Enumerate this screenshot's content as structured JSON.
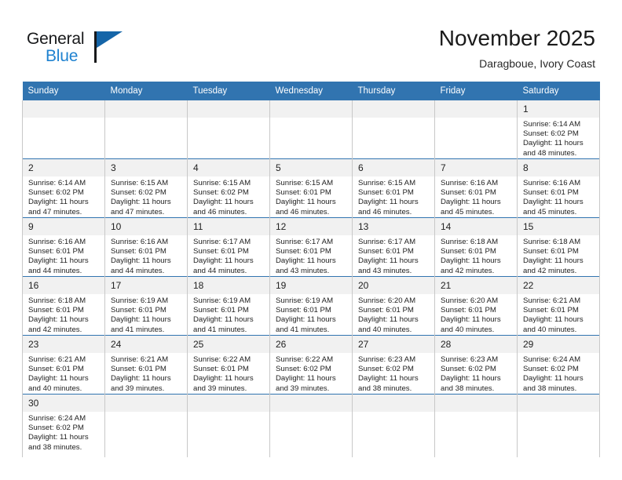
{
  "brand": {
    "name_top": "General",
    "name_bottom": "Blue",
    "flag_icon": "blue-flag-triangle",
    "colors": {
      "dark": "#18191b",
      "blue": "#1f82d0",
      "flag": "#1565a8"
    }
  },
  "header": {
    "title": "November 2025",
    "subtitle": "Daragboue, Ivory Coast"
  },
  "colors": {
    "header_blue": "#3174b0",
    "daynum_band": "#f1f1f1",
    "cell_border": "#c8c8c8",
    "text": "#222222"
  },
  "weekdays": [
    "Sunday",
    "Monday",
    "Tuesday",
    "Wednesday",
    "Thursday",
    "Friday",
    "Saturday"
  ],
  "labels": {
    "sunrise_prefix": "Sunrise:",
    "sunset_prefix": "Sunset:",
    "daylight_prefix": "Daylight:"
  },
  "weeks": [
    [
      {
        "day": "",
        "empty": true
      },
      {
        "day": "",
        "empty": true
      },
      {
        "day": "",
        "empty": true
      },
      {
        "day": "",
        "empty": true
      },
      {
        "day": "",
        "empty": true
      },
      {
        "day": "",
        "empty": true
      },
      {
        "day": "1",
        "sunrise": "Sunrise: 6:14 AM",
        "sunset": "Sunset: 6:02 PM",
        "daylight1": "Daylight: 11 hours",
        "daylight2": "and 48 minutes."
      }
    ],
    [
      {
        "day": "2",
        "sunrise": "Sunrise: 6:14 AM",
        "sunset": "Sunset: 6:02 PM",
        "daylight1": "Daylight: 11 hours",
        "daylight2": "and 47 minutes."
      },
      {
        "day": "3",
        "sunrise": "Sunrise: 6:15 AM",
        "sunset": "Sunset: 6:02 PM",
        "daylight1": "Daylight: 11 hours",
        "daylight2": "and 47 minutes."
      },
      {
        "day": "4",
        "sunrise": "Sunrise: 6:15 AM",
        "sunset": "Sunset: 6:02 PM",
        "daylight1": "Daylight: 11 hours",
        "daylight2": "and 46 minutes."
      },
      {
        "day": "5",
        "sunrise": "Sunrise: 6:15 AM",
        "sunset": "Sunset: 6:01 PM",
        "daylight1": "Daylight: 11 hours",
        "daylight2": "and 46 minutes."
      },
      {
        "day": "6",
        "sunrise": "Sunrise: 6:15 AM",
        "sunset": "Sunset: 6:01 PM",
        "daylight1": "Daylight: 11 hours",
        "daylight2": "and 46 minutes."
      },
      {
        "day": "7",
        "sunrise": "Sunrise: 6:16 AM",
        "sunset": "Sunset: 6:01 PM",
        "daylight1": "Daylight: 11 hours",
        "daylight2": "and 45 minutes."
      },
      {
        "day": "8",
        "sunrise": "Sunrise: 6:16 AM",
        "sunset": "Sunset: 6:01 PM",
        "daylight1": "Daylight: 11 hours",
        "daylight2": "and 45 minutes."
      }
    ],
    [
      {
        "day": "9",
        "sunrise": "Sunrise: 6:16 AM",
        "sunset": "Sunset: 6:01 PM",
        "daylight1": "Daylight: 11 hours",
        "daylight2": "and 44 minutes."
      },
      {
        "day": "10",
        "sunrise": "Sunrise: 6:16 AM",
        "sunset": "Sunset: 6:01 PM",
        "daylight1": "Daylight: 11 hours",
        "daylight2": "and 44 minutes."
      },
      {
        "day": "11",
        "sunrise": "Sunrise: 6:17 AM",
        "sunset": "Sunset: 6:01 PM",
        "daylight1": "Daylight: 11 hours",
        "daylight2": "and 44 minutes."
      },
      {
        "day": "12",
        "sunrise": "Sunrise: 6:17 AM",
        "sunset": "Sunset: 6:01 PM",
        "daylight1": "Daylight: 11 hours",
        "daylight2": "and 43 minutes."
      },
      {
        "day": "13",
        "sunrise": "Sunrise: 6:17 AM",
        "sunset": "Sunset: 6:01 PM",
        "daylight1": "Daylight: 11 hours",
        "daylight2": "and 43 minutes."
      },
      {
        "day": "14",
        "sunrise": "Sunrise: 6:18 AM",
        "sunset": "Sunset: 6:01 PM",
        "daylight1": "Daylight: 11 hours",
        "daylight2": "and 42 minutes."
      },
      {
        "day": "15",
        "sunrise": "Sunrise: 6:18 AM",
        "sunset": "Sunset: 6:01 PM",
        "daylight1": "Daylight: 11 hours",
        "daylight2": "and 42 minutes."
      }
    ],
    [
      {
        "day": "16",
        "sunrise": "Sunrise: 6:18 AM",
        "sunset": "Sunset: 6:01 PM",
        "daylight1": "Daylight: 11 hours",
        "daylight2": "and 42 minutes."
      },
      {
        "day": "17",
        "sunrise": "Sunrise: 6:19 AM",
        "sunset": "Sunset: 6:01 PM",
        "daylight1": "Daylight: 11 hours",
        "daylight2": "and 41 minutes."
      },
      {
        "day": "18",
        "sunrise": "Sunrise: 6:19 AM",
        "sunset": "Sunset: 6:01 PM",
        "daylight1": "Daylight: 11 hours",
        "daylight2": "and 41 minutes."
      },
      {
        "day": "19",
        "sunrise": "Sunrise: 6:19 AM",
        "sunset": "Sunset: 6:01 PM",
        "daylight1": "Daylight: 11 hours",
        "daylight2": "and 41 minutes."
      },
      {
        "day": "20",
        "sunrise": "Sunrise: 6:20 AM",
        "sunset": "Sunset: 6:01 PM",
        "daylight1": "Daylight: 11 hours",
        "daylight2": "and 40 minutes."
      },
      {
        "day": "21",
        "sunrise": "Sunrise: 6:20 AM",
        "sunset": "Sunset: 6:01 PM",
        "daylight1": "Daylight: 11 hours",
        "daylight2": "and 40 minutes."
      },
      {
        "day": "22",
        "sunrise": "Sunrise: 6:21 AM",
        "sunset": "Sunset: 6:01 PM",
        "daylight1": "Daylight: 11 hours",
        "daylight2": "and 40 minutes."
      }
    ],
    [
      {
        "day": "23",
        "sunrise": "Sunrise: 6:21 AM",
        "sunset": "Sunset: 6:01 PM",
        "daylight1": "Daylight: 11 hours",
        "daylight2": "and 40 minutes."
      },
      {
        "day": "24",
        "sunrise": "Sunrise: 6:21 AM",
        "sunset": "Sunset: 6:01 PM",
        "daylight1": "Daylight: 11 hours",
        "daylight2": "and 39 minutes."
      },
      {
        "day": "25",
        "sunrise": "Sunrise: 6:22 AM",
        "sunset": "Sunset: 6:01 PM",
        "daylight1": "Daylight: 11 hours",
        "daylight2": "and 39 minutes."
      },
      {
        "day": "26",
        "sunrise": "Sunrise: 6:22 AM",
        "sunset": "Sunset: 6:02 PM",
        "daylight1": "Daylight: 11 hours",
        "daylight2": "and 39 minutes."
      },
      {
        "day": "27",
        "sunrise": "Sunrise: 6:23 AM",
        "sunset": "Sunset: 6:02 PM",
        "daylight1": "Daylight: 11 hours",
        "daylight2": "and 38 minutes."
      },
      {
        "day": "28",
        "sunrise": "Sunrise: 6:23 AM",
        "sunset": "Sunset: 6:02 PM",
        "daylight1": "Daylight: 11 hours",
        "daylight2": "and 38 minutes."
      },
      {
        "day": "29",
        "sunrise": "Sunrise: 6:24 AM",
        "sunset": "Sunset: 6:02 PM",
        "daylight1": "Daylight: 11 hours",
        "daylight2": "and 38 minutes."
      }
    ],
    [
      {
        "day": "30",
        "sunrise": "Sunrise: 6:24 AM",
        "sunset": "Sunset: 6:02 PM",
        "daylight1": "Daylight: 11 hours",
        "daylight2": "and 38 minutes."
      },
      {
        "day": "",
        "empty": true
      },
      {
        "day": "",
        "empty": true
      },
      {
        "day": "",
        "empty": true
      },
      {
        "day": "",
        "empty": true
      },
      {
        "day": "",
        "empty": true
      },
      {
        "day": "",
        "empty": true
      }
    ]
  ]
}
